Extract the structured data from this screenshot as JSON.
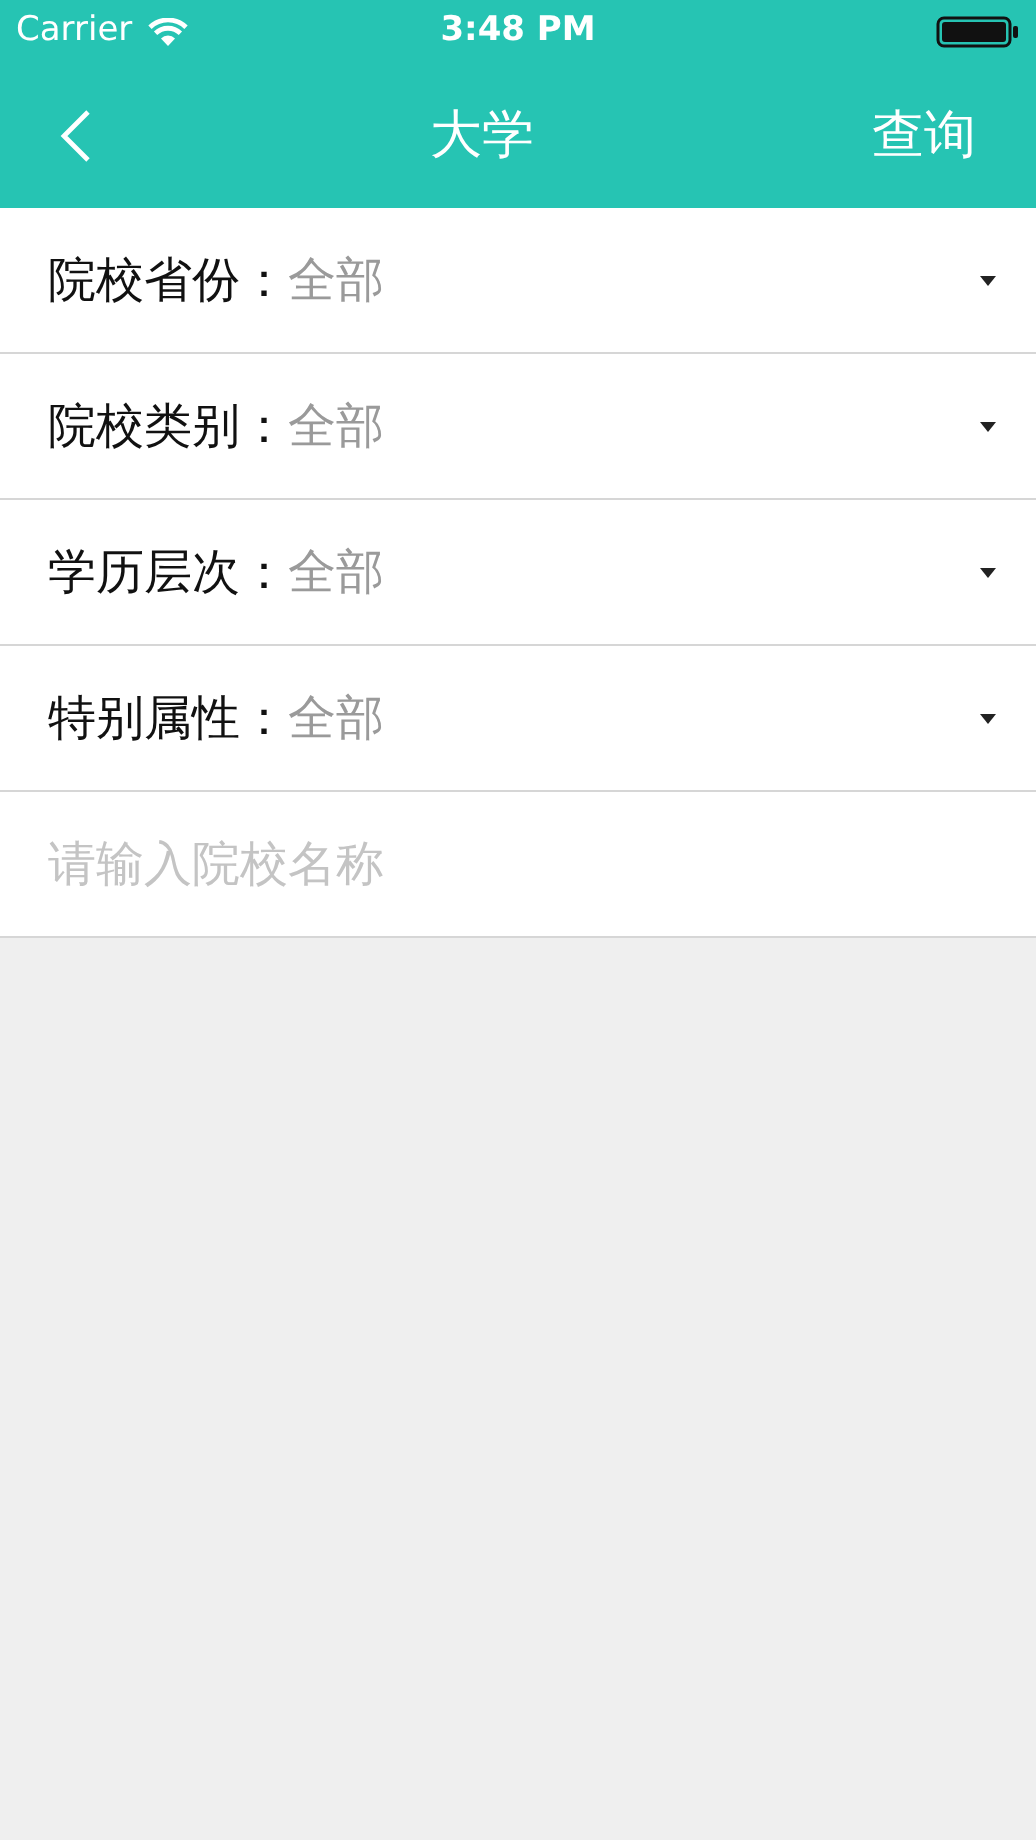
{
  "status_bar": {
    "carrier": "Carrier",
    "time": "3:48 PM"
  },
  "nav_bar": {
    "title": "大学",
    "action": "查询"
  },
  "filters": [
    {
      "label": "院校省份：",
      "value": "全部"
    },
    {
      "label": "院校类别：",
      "value": "全部"
    },
    {
      "label": "学历层次：",
      "value": "全部"
    },
    {
      "label": "特别属性：",
      "value": "全部"
    }
  ],
  "search": {
    "placeholder": "请输入院校名称"
  }
}
